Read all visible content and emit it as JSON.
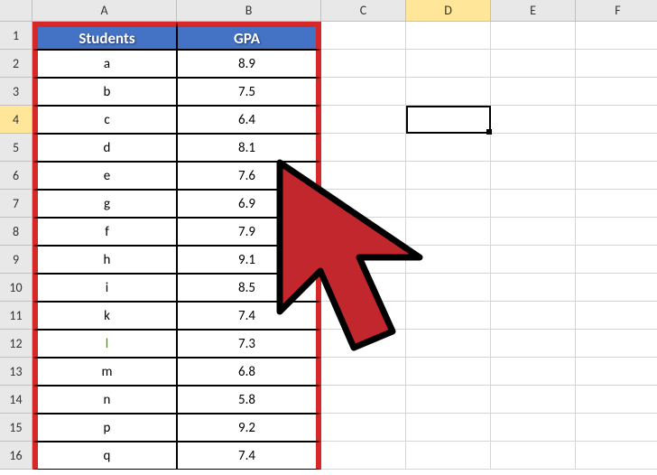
{
  "columns": [
    "A",
    "B",
    "C",
    "D",
    "E",
    "F"
  ],
  "selected_column_index": 3,
  "selected_row_index": 3,
  "rows": [
    1,
    2,
    3,
    4,
    5,
    6,
    7,
    8,
    9,
    10,
    11,
    12,
    13,
    14,
    15,
    16
  ],
  "table": {
    "headers": [
      "Students",
      "GPA"
    ],
    "data": [
      {
        "student": "a",
        "gpa": "8.9"
      },
      {
        "student": "b",
        "gpa": "7.5"
      },
      {
        "student": "c",
        "gpa": "6.4"
      },
      {
        "student": "d",
        "gpa": "8.1"
      },
      {
        "student": "e",
        "gpa": "7.6"
      },
      {
        "student": "g",
        "gpa": "6.9"
      },
      {
        "student": "f",
        "gpa": "7.9"
      },
      {
        "student": "h",
        "gpa": "9.1"
      },
      {
        "student": "i",
        "gpa": "8.5"
      },
      {
        "student": "k",
        "gpa": "7.4"
      },
      {
        "student": "l",
        "gpa": "7.3",
        "green": true
      },
      {
        "student": "m",
        "gpa": "6.8"
      },
      {
        "student": "n",
        "gpa": "5.8"
      },
      {
        "student": "p",
        "gpa": "9.2"
      },
      {
        "student": "q",
        "gpa": "7.4"
      }
    ]
  },
  "active_cell": "D4"
}
